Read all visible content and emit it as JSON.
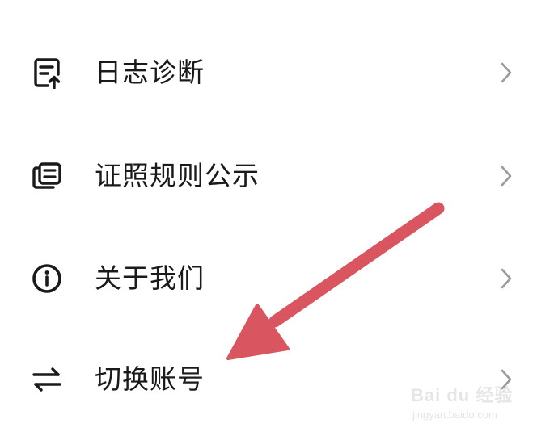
{
  "menu": {
    "items": [
      {
        "label": "日志诊断",
        "icon": "log-upload-icon"
      },
      {
        "label": "证照规则公示",
        "icon": "certificate-icon"
      },
      {
        "label": "关于我们",
        "icon": "info-icon"
      },
      {
        "label": "切换账号",
        "icon": "switch-arrows-icon"
      }
    ]
  },
  "annotation": {
    "arrow_color": "#d9555f",
    "icon": "red-pointer-arrow-icon"
  },
  "watermark": {
    "brand": "Bai du 经验",
    "url": "jingyan.baidu.com"
  },
  "colors": {
    "text": "#1a1a1a",
    "chevron": "#9a9a9a",
    "background": "#ffffff"
  }
}
